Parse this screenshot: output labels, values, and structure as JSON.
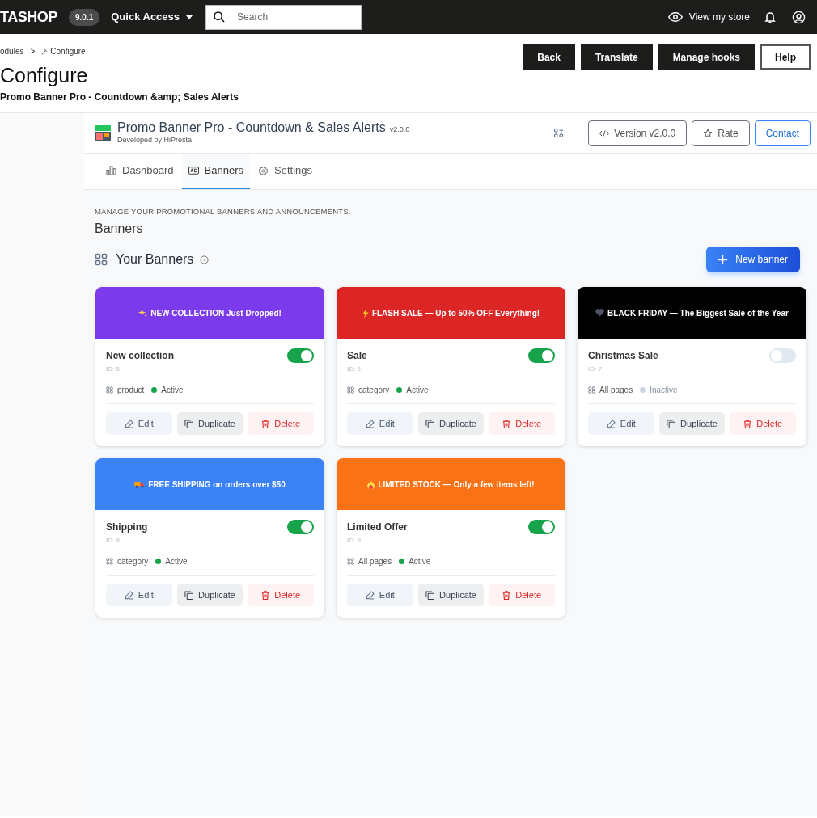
{
  "topbar": {
    "logo": "TASHOP",
    "version": "9.0.1",
    "quick_access": "Quick Access",
    "search": {
      "placeholder": "Search"
    },
    "view_store": "View my store"
  },
  "breadcrumb": [
    "odules",
    ">",
    "Configure"
  ],
  "page_title": "Configure",
  "page_subtitle": "Promo Banner Pro - Countdown &amp; Sales Alerts",
  "header_buttons": [
    {
      "label": "Back",
      "kind": "dark"
    },
    {
      "label": "Translate",
      "kind": "dark"
    },
    {
      "label": "Manage hooks",
      "kind": "dark"
    },
    {
      "label": "Help",
      "kind": "outline"
    }
  ],
  "module": {
    "name": "Promo Banner Pro - Countdown & Sales Alerts",
    "version": "v2.0.0",
    "developer": "Developed by HiPresta",
    "buttons": [
      {
        "label": "Version v2.0.0",
        "kind": "code"
      },
      {
        "label": "Rate",
        "kind": "star"
      },
      {
        "label": "Contact",
        "kind": "primary"
      }
    ]
  },
  "tabs": [
    {
      "label": "Dashboard",
      "selected": false
    },
    {
      "label": "Banners",
      "selected": true
    },
    {
      "label": "Settings",
      "selected": false
    }
  ],
  "section": {
    "overline": "MANAGE YOUR PROMOTIONAL BANNERS AND ANNOUNCEMENTS.",
    "title": "Banners",
    "list_title": "Your Banners",
    "new_button": "New banner"
  },
  "banners": [
    {
      "banner_text": "NEW COLLECTION Just Dropped!",
      "color": "#7c3aed",
      "name": "New collection",
      "id": "ID: 5",
      "scope": "product",
      "status": "Active",
      "on": true,
      "actions": [
        "Edit",
        "Duplicate",
        "Delete"
      ]
    },
    {
      "banner_text": "FLASH SALE — Up to 50% OFF Everything!",
      "color": "#dc2626",
      "name": "Sale",
      "id": "ID: 6",
      "scope": "category",
      "status": "Active",
      "on": true,
      "actions": [
        "Edit",
        "Duplicate",
        "Delete"
      ]
    },
    {
      "banner_text": "BLACK FRIDAY — The Biggest Sale of the Year",
      "color": "#000000",
      "name": "Christmas Sale",
      "id": "ID: 7",
      "scope": "All pages",
      "status": "Inactive",
      "on": false,
      "actions": [
        "Edit",
        "Duplicate",
        "Delete"
      ]
    },
    {
      "banner_text": "FREE SHIPPING on orders over $50",
      "color": "#3b82f6",
      "name": "Shipping",
      "id": "ID: 8",
      "scope": "category",
      "status": "Active",
      "on": true,
      "actions": [
        "Edit",
        "Duplicate",
        "Delete"
      ]
    },
    {
      "banner_text": "LIMITED STOCK — Only a few items left!",
      "color": "#f97316",
      "name": "Limited Offer",
      "id": "ID: 9",
      "scope": "All pages",
      "status": "Active",
      "on": true,
      "actions": [
        "Edit",
        "Duplicate",
        "Delete"
      ]
    }
  ]
}
